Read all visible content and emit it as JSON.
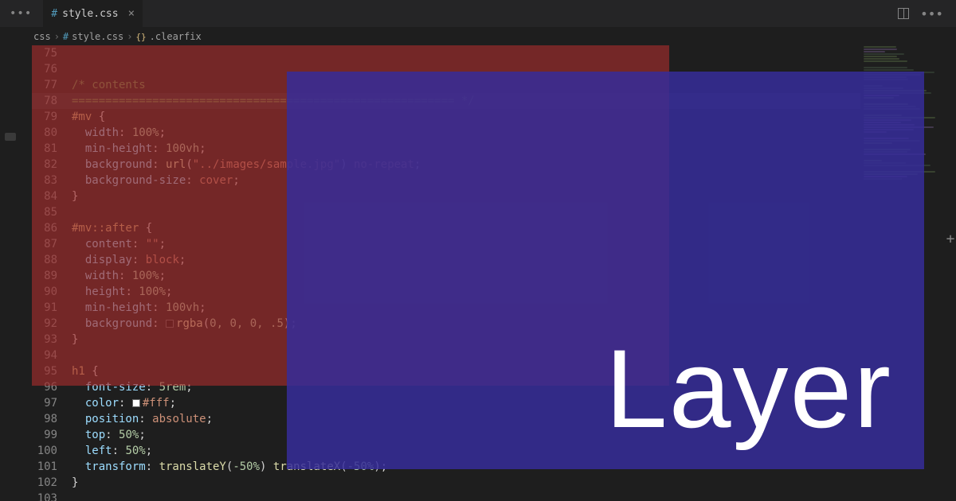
{
  "titlebar": {
    "menu_dots": "•••",
    "right_dots": "•••"
  },
  "tab": {
    "icon": "#",
    "label": "style.css",
    "close": "×"
  },
  "breadcrumbs": {
    "seg1": "css",
    "seg2_icon": "#",
    "seg2": "style.css",
    "seg3_icon": "{}",
    "seg3": ".clearfix",
    "sep": "›"
  },
  "overlay": {
    "text": "Layer"
  },
  "lines": [
    {
      "n": 75,
      "tokens": []
    },
    {
      "n": 76,
      "tokens": []
    },
    {
      "n": 77,
      "tokens": [
        [
          "c-comment",
          "/* contents"
        ]
      ]
    },
    {
      "n": 78,
      "hl": true,
      "tokens": [
        [
          "c-comment",
          "========================================================= */"
        ]
      ]
    },
    {
      "n": 79,
      "tokens": [
        [
          "c-selector",
          "#mv"
        ],
        [
          "c-punct",
          " {"
        ]
      ]
    },
    {
      "n": 80,
      "indent": 1,
      "tokens": [
        [
          "c-prop",
          "width"
        ],
        [
          "c-punct",
          ": "
        ],
        [
          "c-number",
          "100%"
        ],
        [
          "c-punct",
          ";"
        ]
      ]
    },
    {
      "n": 81,
      "indent": 1,
      "tokens": [
        [
          "c-prop",
          "min-height"
        ],
        [
          "c-punct",
          ": "
        ],
        [
          "c-number",
          "100vh"
        ],
        [
          "c-punct",
          ";"
        ]
      ]
    },
    {
      "n": 82,
      "indent": 1,
      "tokens": [
        [
          "c-prop",
          "background"
        ],
        [
          "c-punct",
          ": "
        ],
        [
          "c-func",
          "url"
        ],
        [
          "c-punct",
          "("
        ],
        [
          "c-string",
          "\"../images/sample.jpg\""
        ],
        [
          "c-punct",
          ") "
        ],
        [
          "c-value",
          "no-repeat"
        ],
        [
          "c-punct",
          ";"
        ]
      ]
    },
    {
      "n": 83,
      "indent": 1,
      "tokens": [
        [
          "c-prop",
          "background-size"
        ],
        [
          "c-punct",
          ": "
        ],
        [
          "c-value",
          "cover"
        ],
        [
          "c-punct",
          ";"
        ]
      ]
    },
    {
      "n": 84,
      "tokens": [
        [
          "c-punct",
          "}"
        ]
      ]
    },
    {
      "n": 85,
      "tokens": []
    },
    {
      "n": 86,
      "tokens": [
        [
          "c-selector",
          "#mv::after"
        ],
        [
          "c-punct",
          " {"
        ]
      ]
    },
    {
      "n": 87,
      "indent": 1,
      "tokens": [
        [
          "c-prop",
          "content"
        ],
        [
          "c-punct",
          ": "
        ],
        [
          "c-string",
          "\"\""
        ],
        [
          "c-punct",
          ";"
        ]
      ]
    },
    {
      "n": 88,
      "indent": 1,
      "tokens": [
        [
          "c-prop",
          "display"
        ],
        [
          "c-punct",
          ": "
        ],
        [
          "c-value",
          "block"
        ],
        [
          "c-punct",
          ";"
        ]
      ]
    },
    {
      "n": 89,
      "indent": 1,
      "tokens": [
        [
          "c-prop",
          "width"
        ],
        [
          "c-punct",
          ": "
        ],
        [
          "c-number",
          "100%"
        ],
        [
          "c-punct",
          ";"
        ]
      ]
    },
    {
      "n": 90,
      "indent": 1,
      "tokens": [
        [
          "c-prop",
          "height"
        ],
        [
          "c-punct",
          ": "
        ],
        [
          "c-number",
          "100%"
        ],
        [
          "c-punct",
          ";"
        ]
      ]
    },
    {
      "n": 91,
      "indent": 1,
      "tokens": [
        [
          "c-prop",
          "min-height"
        ],
        [
          "c-punct",
          ": "
        ],
        [
          "c-number",
          "100vh"
        ],
        [
          "c-punct",
          ";"
        ]
      ]
    },
    {
      "n": 92,
      "indent": 1,
      "swatch": "#00000080",
      "tokens": [
        [
          "c-prop",
          "background"
        ],
        [
          "c-punct",
          ": "
        ],
        [
          "c-func",
          "rgba"
        ],
        [
          "c-punct",
          "("
        ],
        [
          "c-number",
          "0, 0, 0, .5"
        ],
        [
          "c-punct",
          ");"
        ]
      ]
    },
    {
      "n": 93,
      "tokens": [
        [
          "c-punct",
          "}"
        ]
      ]
    },
    {
      "n": 94,
      "tokens": []
    },
    {
      "n": 95,
      "tokens": [
        [
          "c-selector",
          "h1"
        ],
        [
          "c-punct",
          " {"
        ]
      ]
    },
    {
      "n": 96,
      "indent": 1,
      "tokens": [
        [
          "c-prop",
          "font-size"
        ],
        [
          "c-punct",
          ": "
        ],
        [
          "c-number",
          "5rem"
        ],
        [
          "c-punct",
          ";"
        ]
      ]
    },
    {
      "n": 97,
      "indent": 1,
      "swatch": "#ffffff",
      "tokens": [
        [
          "c-prop",
          "color"
        ],
        [
          "c-punct",
          ": "
        ],
        [
          "c-value",
          "#fff"
        ],
        [
          "c-punct",
          ";"
        ]
      ]
    },
    {
      "n": 98,
      "indent": 1,
      "tokens": [
        [
          "c-prop",
          "position"
        ],
        [
          "c-punct",
          ": "
        ],
        [
          "c-value",
          "absolute"
        ],
        [
          "c-punct",
          ";"
        ]
      ]
    },
    {
      "n": 99,
      "indent": 1,
      "tokens": [
        [
          "c-prop",
          "top"
        ],
        [
          "c-punct",
          ": "
        ],
        [
          "c-number",
          "50%"
        ],
        [
          "c-punct",
          ";"
        ]
      ]
    },
    {
      "n": 100,
      "indent": 1,
      "tokens": [
        [
          "c-prop",
          "left"
        ],
        [
          "c-punct",
          ": "
        ],
        [
          "c-number",
          "50%"
        ],
        [
          "c-punct",
          ";"
        ]
      ]
    },
    {
      "n": 101,
      "indent": 1,
      "tokens": [
        [
          "c-prop",
          "transform"
        ],
        [
          "c-punct",
          ": "
        ],
        [
          "c-func",
          "translateY"
        ],
        [
          "c-punct",
          "("
        ],
        [
          "c-number",
          "-50%"
        ],
        [
          "c-punct",
          ") "
        ],
        [
          "c-func",
          "translateX"
        ],
        [
          "c-punct",
          "("
        ],
        [
          "c-number",
          "-50%"
        ],
        [
          "c-punct",
          ");"
        ]
      ]
    },
    {
      "n": 102,
      "tokens": [
        [
          "c-punct",
          "}"
        ]
      ]
    },
    {
      "n": 103,
      "tokens": []
    }
  ]
}
